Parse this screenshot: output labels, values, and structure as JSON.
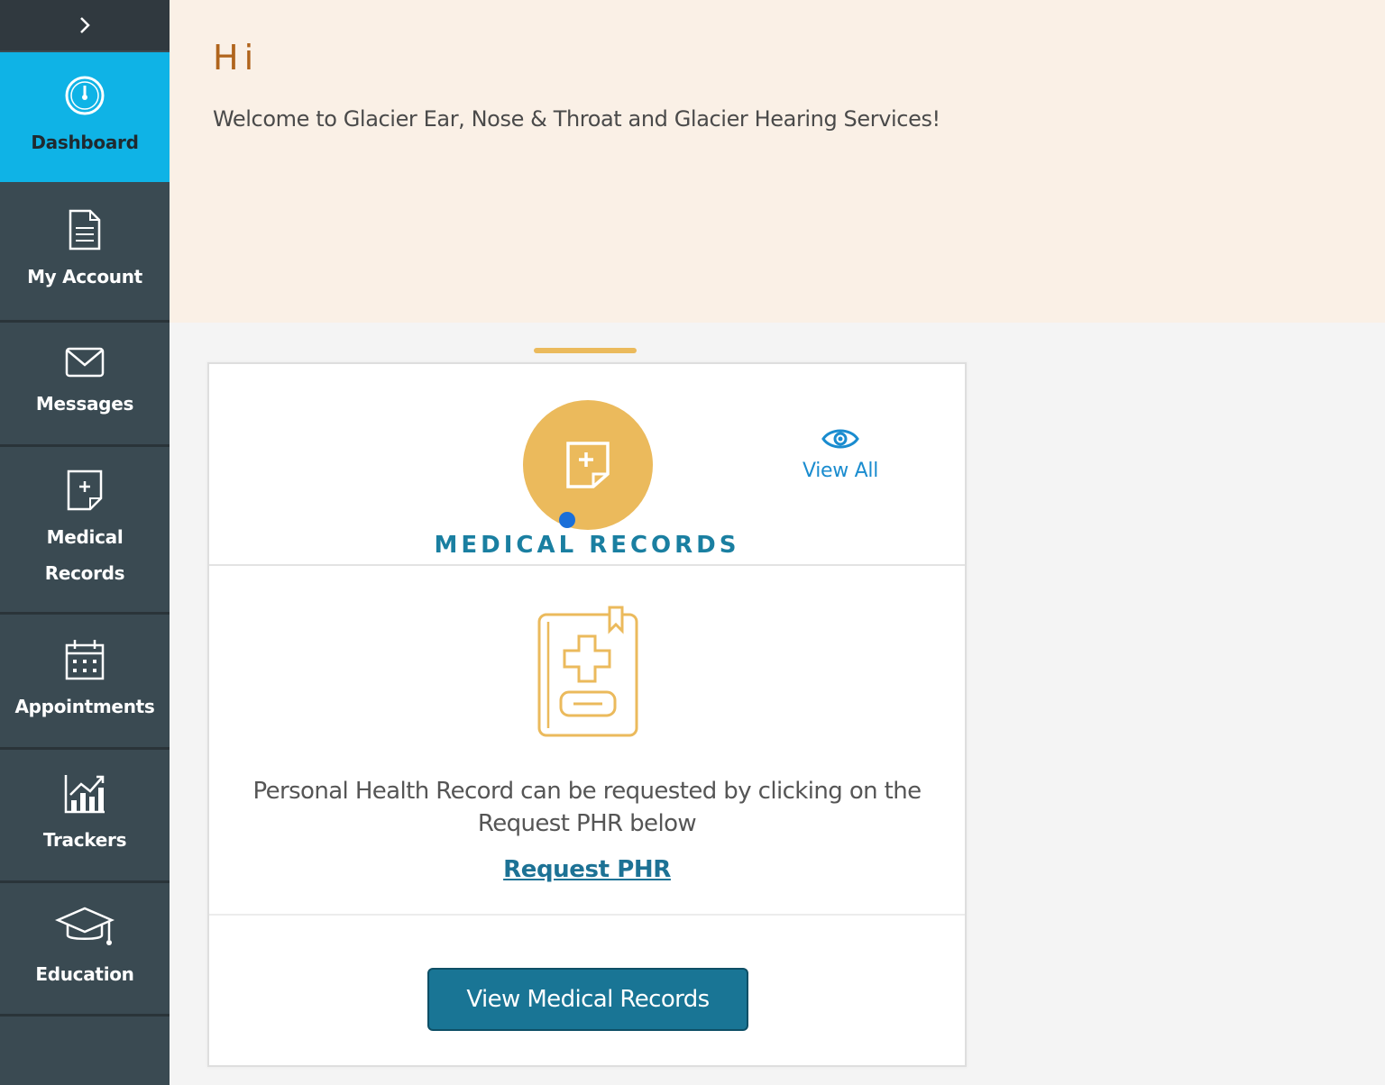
{
  "sidebar": {
    "items": [
      {
        "label": "Dashboard",
        "icon": "dashboard-gauge-icon",
        "active": true
      },
      {
        "label": "My Account",
        "icon": "document-icon"
      },
      {
        "label": "Messages",
        "icon": "envelope-icon"
      },
      {
        "label": "Medical Records",
        "icon": "medical-file-icon"
      },
      {
        "label": "Appointments",
        "icon": "calendar-icon"
      },
      {
        "label": "Trackers",
        "icon": "bar-chart-icon"
      },
      {
        "label": "Education",
        "icon": "graduation-cap-icon"
      }
    ]
  },
  "header": {
    "greeting": "Hi",
    "welcome": "Welcome to Glacier Ear, Nose & Throat and Glacier Hearing Services!"
  },
  "card": {
    "title": "MEDICAL RECORDS",
    "view_all": "View All",
    "info": "Personal Health Record can be requested by clicking on the Request PHR below",
    "request_link": "Request PHR",
    "button": "View Medical Records"
  },
  "colors": {
    "sidebar_bg": "#3a4a52",
    "active_item": "#0fb3e6",
    "header_bg": "#faf0e6",
    "accent_gold": "#ebba5c",
    "primary_blue": "#197595"
  }
}
